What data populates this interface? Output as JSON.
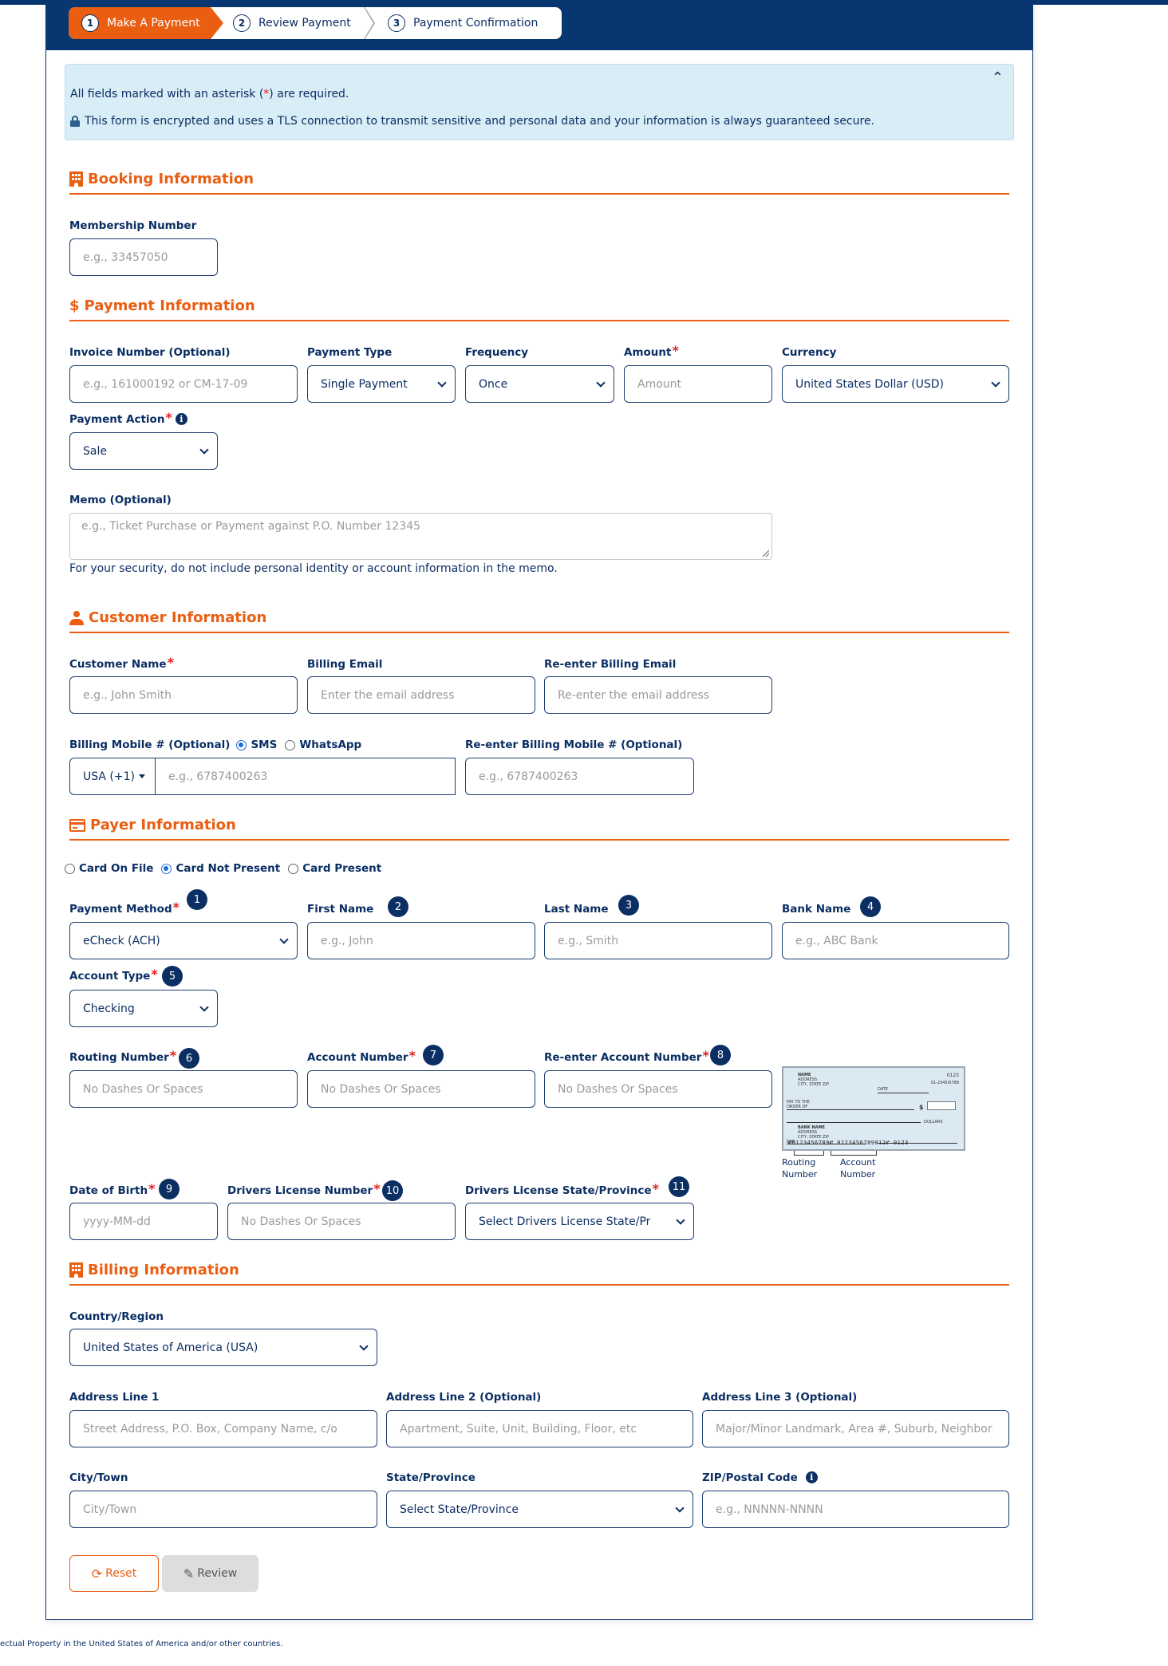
{
  "stepper": {
    "steps": [
      {
        "num": "1",
        "label": "Make A Payment",
        "active": true
      },
      {
        "num": "2",
        "label": "Review Payment",
        "active": false
      },
      {
        "num": "3",
        "label": "Payment Confirmation",
        "active": false
      }
    ]
  },
  "notice": {
    "required_prefix": "All fields marked with an asterisk (",
    "required_star": "*",
    "required_suffix": ") are required.",
    "security": "This form is encrypted and uses a TLS connection to transmit sensitive and personal data and your information is always guaranteed secure.",
    "collapse_icon": "^"
  },
  "booking": {
    "title": "Booking Information",
    "icon": "building-icon",
    "membership_label": "Membership Number",
    "membership_placeholder": "e.g., 33457050"
  },
  "payment": {
    "title": "Payment Information",
    "icon": "$",
    "invoice_label": "Invoice Number (Optional)",
    "invoice_placeholder": "e.g., 161000192 or CM-17-09",
    "type_label": "Payment Type",
    "type_value": "Single Payment",
    "frequency_label": "Frequency",
    "frequency_value": "Once",
    "amount_label": "Amount",
    "amount_placeholder": "Amount",
    "currency_label": "Currency",
    "currency_value": "United States Dollar (USD)",
    "action_label": "Payment Action",
    "action_value": "Sale",
    "memo_label": "Memo (Optional)",
    "memo_placeholder": "e.g., Ticket Purchase or Payment against P.O. Number 12345",
    "memo_help": "For your security, do not include personal identity or account information in the memo."
  },
  "customer": {
    "title": "Customer Information",
    "name_label": "Customer Name",
    "name_placeholder": "e.g., John Smith",
    "email_label": "Billing Email",
    "email_placeholder": "Enter the email address",
    "reemail_label": "Re-enter Billing Email",
    "reemail_placeholder": "Re-enter the email address",
    "mobile_label": "Billing Mobile # (Optional)",
    "mobile_opt_sms": "SMS",
    "mobile_opt_whatsapp": "WhatsApp",
    "mobile_prefix": "USA (+1)",
    "mobile_placeholder": "e.g., 6787400263",
    "remobile_label": "Re-enter Billing Mobile # (Optional)",
    "remobile_placeholder": "e.g., 6787400263"
  },
  "payer": {
    "title": "Payer Information",
    "modes": [
      "Card On File",
      "Card Not Present",
      "Card Present"
    ],
    "selected_mode": "Card Not Present",
    "method_label": "Payment Method",
    "method_value": "eCheck (ACH)",
    "first_label": "First Name",
    "first_placeholder": "e.g., John",
    "last_label": "Last Name",
    "last_placeholder": "e.g., Smith",
    "bank_label": "Bank Name",
    "bank_placeholder": "e.g., ABC Bank",
    "acct_type_label": "Account Type",
    "acct_type_value": "Checking",
    "routing_label": "Routing Number",
    "routing_placeholder": "No Dashes Or Spaces",
    "account_label": "Account Number",
    "account_placeholder": "No Dashes Or Spaces",
    "reaccount_label": "Re-enter Account Number",
    "reaccount_placeholder": "No Dashes Or Spaces",
    "dob_label": "Date of Birth",
    "dob_placeholder": "yyyy-MM-dd",
    "dl_label": "Drivers License Number",
    "dl_placeholder": "No Dashes Or Spaces",
    "dl_state_label": "Drivers License State/Province",
    "dl_state_value": "Select Drivers License State/Pr",
    "badges": [
      "1",
      "2",
      "3",
      "4",
      "5",
      "6",
      "7",
      "8",
      "9",
      "10",
      "11"
    ],
    "check": {
      "name": "NAME",
      "address": "ADDRESS",
      "city": "CITY, STATE ZIP",
      "check_no": "0123",
      "fraction": "01-2345/6789",
      "date": "DATE",
      "payto": "PAY TO THE ORDER OF",
      "dollar": "$",
      "dollars": "DOLLARS",
      "bank_name": "BANK NAME",
      "bank_address": "ADDRESS",
      "bank_city": "CITY, STATE ZIP",
      "for": "FOR",
      "micr": "⑆0123456789⑆ 0123456789012⑈ 0123",
      "routing_caption_1": "Routing",
      "routing_caption_2": "Number",
      "account_caption_1": "Account",
      "account_caption_2": "Number"
    }
  },
  "billing": {
    "title": "Billing Information",
    "country_label": "Country/Region",
    "country_value": "United States of America (USA)",
    "addr1_label": "Address Line 1",
    "addr1_placeholder": "Street Address, P.O. Box, Company Name, c/o",
    "addr2_label": "Address Line 2 (Optional)",
    "addr2_placeholder": "Apartment, Suite, Unit, Building, Floor, etc",
    "addr3_label": "Address Line 3 (Optional)",
    "addr3_placeholder": "Major/Minor Landmark, Area #, Suburb, Neighbor",
    "city_label": "City/Town",
    "city_placeholder": "City/Town",
    "state_label": "State/Province",
    "state_value": "Select State/Province",
    "zip_label": "ZIP/Postal Code",
    "zip_placeholder": "e.g., NNNNN-NNNN"
  },
  "actions": {
    "reset_label": "Reset",
    "review_label": "Review"
  },
  "footer": {
    "text": "ectual Property in the United States of America and/or other countries."
  },
  "colors": {
    "brand_navy": "#073670",
    "accent_orange": "#ea5e12",
    "notice_bg": "#d9edf7",
    "required_red": "#e01e1e"
  }
}
